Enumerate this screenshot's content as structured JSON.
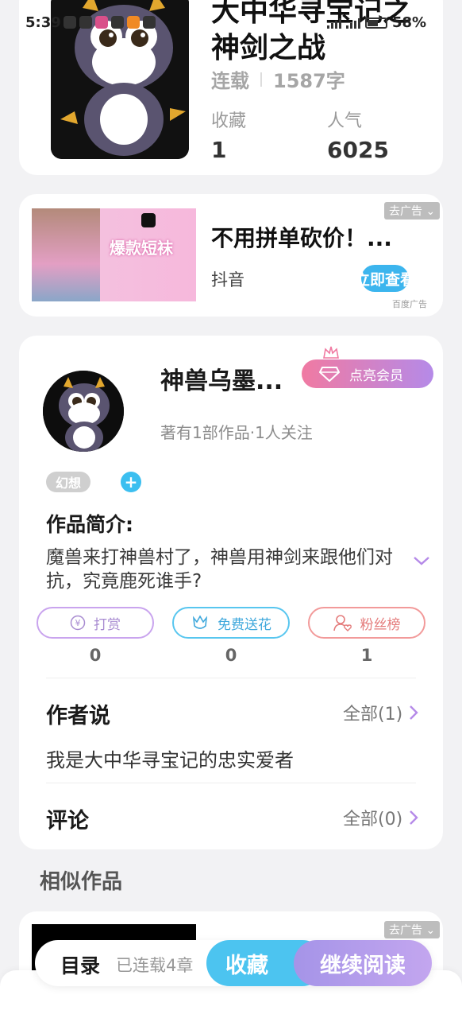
{
  "status_bar": {
    "time": "5:39",
    "battery": "58%"
  },
  "book": {
    "title": "大中华寻宝记之神剑之战",
    "status": "连载",
    "word_count": "1587字",
    "favorites_label": "收藏",
    "favorites_value": "1",
    "popularity_label": "人气",
    "popularity_value": "6025"
  },
  "ad": {
    "tag": "去广告",
    "image_text": "爆款短袜",
    "title": "不用拼单砍价！...",
    "source": "抖音",
    "cta": "立即查看",
    "provider": "百度广告"
  },
  "author": {
    "name": "神兽乌墨...",
    "vip_button": "点亮会员",
    "stats": "著有1部作品·1人关注",
    "tag": "幻想",
    "tag_add": "+",
    "intro_label": "作品简介:",
    "intro_text": "魔兽来打神兽村了，神兽用神剑来跟他们对抗，究竟鹿死谁手?",
    "actions": [
      {
        "label": "打赏",
        "count": "0",
        "color": "#a88bd1"
      },
      {
        "label": "免费送花",
        "count": "0",
        "color": "#3fa8dc"
      },
      {
        "label": "粉丝榜",
        "count": "1",
        "color": "#e47b7b"
      }
    ],
    "author_says_title": "作者说",
    "author_says_link": "全部(1)",
    "author_says_text": "我是大中华寻宝记的忠实爱者",
    "comments_title": "评论",
    "comments_link": "全部(0)"
  },
  "similar": {
    "title": "相似作品",
    "ad_tag": "去广告"
  },
  "bottom_bar": {
    "toc": "目录",
    "updated": "已连载4章",
    "favorite": "收藏",
    "continue": "继续阅读"
  },
  "colors": {
    "accent_blue": "#4cc4f0",
    "accent_purple": "#b58ae8",
    "vip_pink": "#f07aa2"
  }
}
